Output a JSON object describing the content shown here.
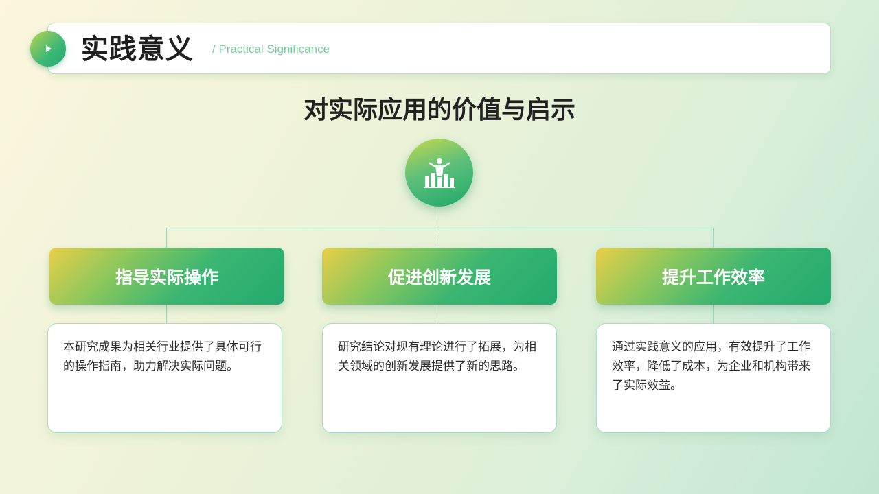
{
  "header": {
    "title": "实践意义",
    "subtitle": "/ Practical Significance",
    "badge_icon": "play-icon"
  },
  "main_title": "对实际应用的价值与启示",
  "hub_icon": "presentation-chart-icon",
  "colors": {
    "accent_green": "#22a86c",
    "accent_yellow": "#e9cf48",
    "subtitle_green": "#7cc9a0"
  },
  "cards": [
    {
      "title": "指导实际操作",
      "text": "本研究成果为相关行业提供了具体可行的操作指南，助力解决实际问题。"
    },
    {
      "title": "促进创新发展",
      "text": "研究结论对现有理论进行了拓展，为相关领域的创新发展提供了新的思路。"
    },
    {
      "title": "提升工作效率",
      "text": "通过实践意义的应用，有效提升了工作效率，降低了成本，为企业和机构带来了实际效益。"
    }
  ]
}
